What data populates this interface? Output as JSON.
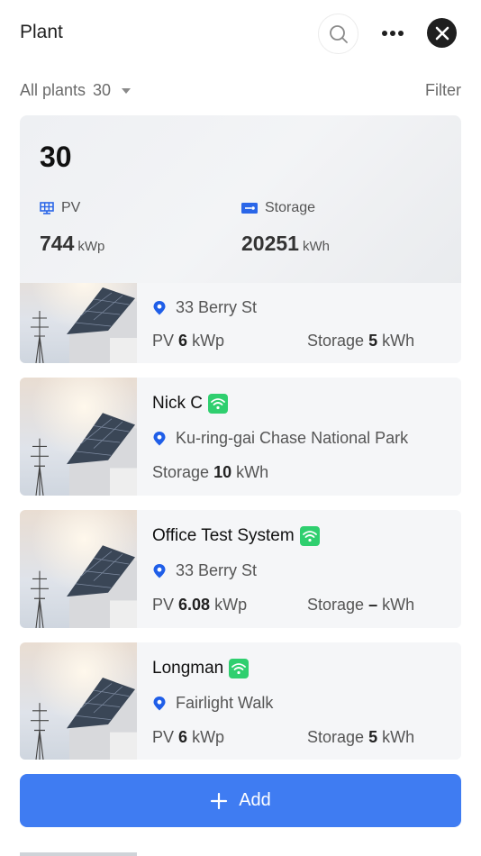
{
  "header": {
    "title": "Plant"
  },
  "filter": {
    "all_plants_label": "All plants",
    "count": "30",
    "filter_label": "Filter"
  },
  "summary": {
    "total": "30",
    "pv": {
      "label": "PV",
      "value": "744",
      "unit": "kWp"
    },
    "storage": {
      "label": "Storage",
      "value": "20251",
      "unit": "kWh"
    }
  },
  "plants": [
    {
      "name": "",
      "online": false,
      "location": "33 Berry St",
      "pv_label": "PV",
      "pv_value": "6",
      "pv_unit": "kWp",
      "storage_label": "Storage",
      "storage_value": "5",
      "storage_unit": "kWh"
    },
    {
      "name": "Nick C",
      "online": true,
      "location": "Ku-ring-gai Chase National Park",
      "storage_label": "Storage",
      "storage_value": "10",
      "storage_unit": "kWh"
    },
    {
      "name": "Office Test System",
      "online": true,
      "location": "33 Berry St",
      "pv_label": "PV",
      "pv_value": "6.08",
      "pv_unit": "kWp",
      "storage_label": "Storage",
      "storage_value": "–",
      "storage_unit": "kWh"
    },
    {
      "name": "Longman",
      "online": true,
      "location": "Fairlight Walk",
      "pv_label": "PV",
      "pv_value": "6",
      "pv_unit": "kWp",
      "storage_label": "Storage",
      "storage_value": "5",
      "storage_unit": "kWh"
    }
  ],
  "add_button": {
    "label": "Add"
  },
  "colors": {
    "accent": "#3f7cf2",
    "online": "#2fcf6f",
    "location_pin": "#1f5ee8"
  }
}
